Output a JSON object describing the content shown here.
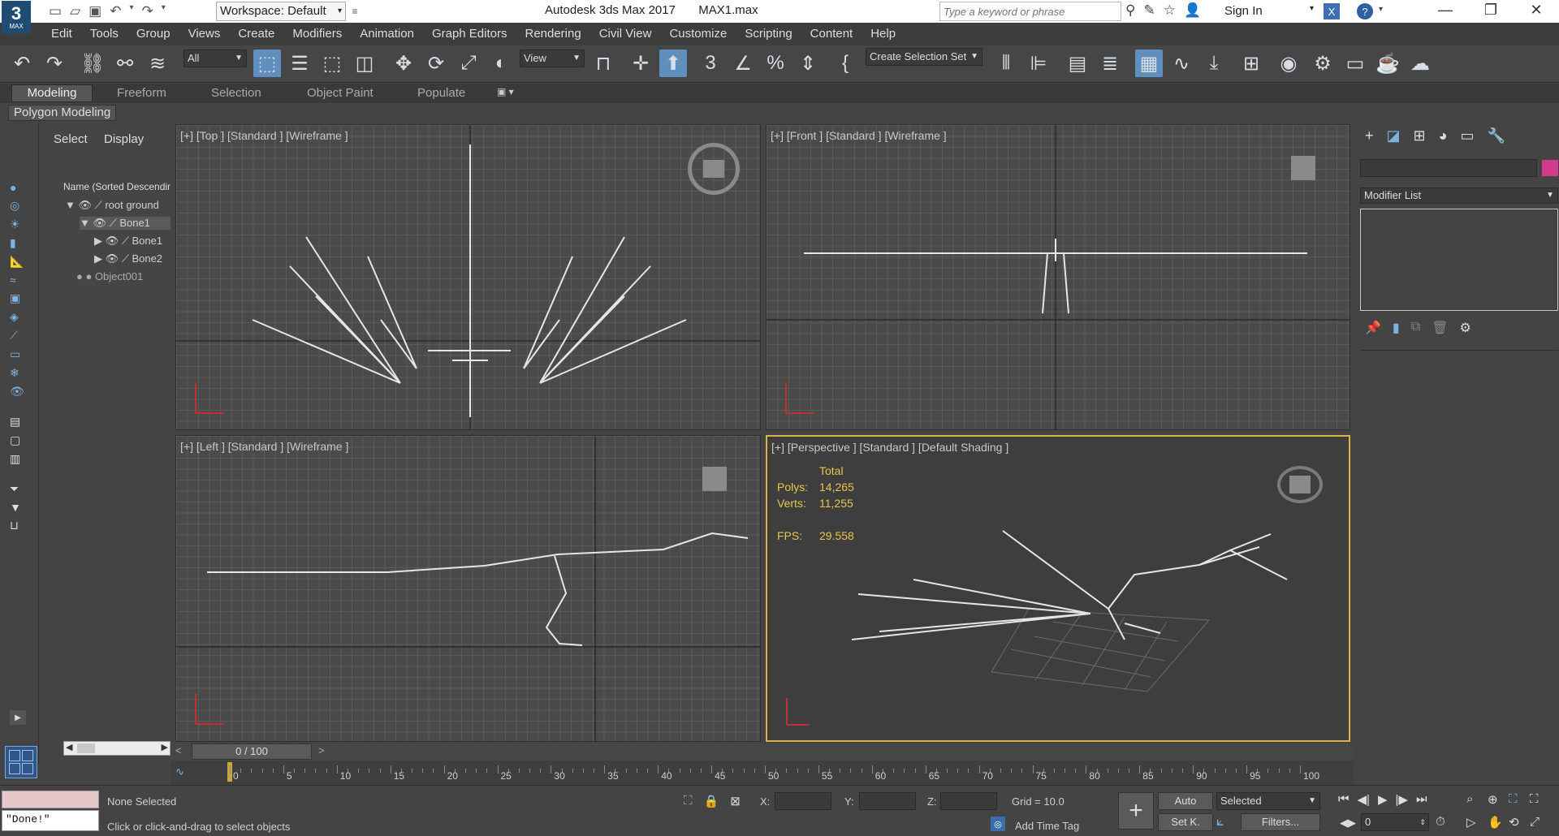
{
  "title": {
    "workspace_label": "Workspace: Default",
    "app": "Autodesk 3ds Max 2017",
    "file": "MAX1.max",
    "search_placeholder": "Type a keyword or phrase",
    "sign_in": "Sign In",
    "logo_text": "MAX"
  },
  "menu": [
    "Edit",
    "Tools",
    "Group",
    "Views",
    "Create",
    "Modifiers",
    "Animation",
    "Graph Editors",
    "Rendering",
    "Civil View",
    "Customize",
    "Scripting",
    "Content",
    "Help"
  ],
  "toolbar": {
    "filter_select": "All",
    "view_select": "View",
    "selection_set": "Create Selection Set"
  },
  "ribbon": {
    "tabs": [
      "Modeling",
      "Freeform",
      "Selection",
      "Object Paint",
      "Populate"
    ],
    "sub_label": "Polygon Modeling"
  },
  "scene_explorer": {
    "tabs": [
      "Select",
      "Display"
    ],
    "column_header": "Name (Sorted Descending)",
    "items": [
      "root ground",
      "Bone1",
      "Bone1",
      "Bone2",
      "Object001"
    ]
  },
  "viewports": {
    "top": "[+] [Top ] [Standard ] [Wireframe ]",
    "front": "[+] [Front ] [Standard ] [Wireframe ]",
    "left": "[+] [Left ] [Standard ] [Wireframe ]",
    "persp": "[+] [Perspective ] [Standard ] [Default Shading ]",
    "stats": {
      "total_label": "Total",
      "polys_label": "Polys:",
      "polys": "14,265",
      "verts_label": "Verts:",
      "verts": "11,255",
      "fps_label": "FPS:",
      "fps": "29.558"
    }
  },
  "command_panel": {
    "modifier_list": "Modifier List"
  },
  "timeline": {
    "frame_counter": "0 / 100",
    "ticks": [
      "0",
      "5",
      "10",
      "15",
      "20",
      "25",
      "30",
      "35",
      "40",
      "45",
      "50",
      "55",
      "60",
      "65",
      "70",
      "75",
      "80",
      "85",
      "90",
      "95",
      "100"
    ]
  },
  "status": {
    "maxscript_text": "\"Done!\"",
    "selection_status": "None Selected",
    "prompt": "Click or click-and-drag to select objects",
    "x_label": "X:",
    "y_label": "Y:",
    "z_label": "Z:",
    "grid": "Grid = 10.0",
    "add_time_tag": "Add Time Tag",
    "auto": "Auto",
    "set_key": "Set K.",
    "selected": "Selected",
    "filters": "Filters...",
    "current_frame": "0"
  },
  "colors": {
    "accent_blue": "#4aa3df",
    "stats_yellow": "#e5c84a",
    "object_color_swatch": "#d23a8c",
    "viewport_active_border": "#d8b24c"
  }
}
